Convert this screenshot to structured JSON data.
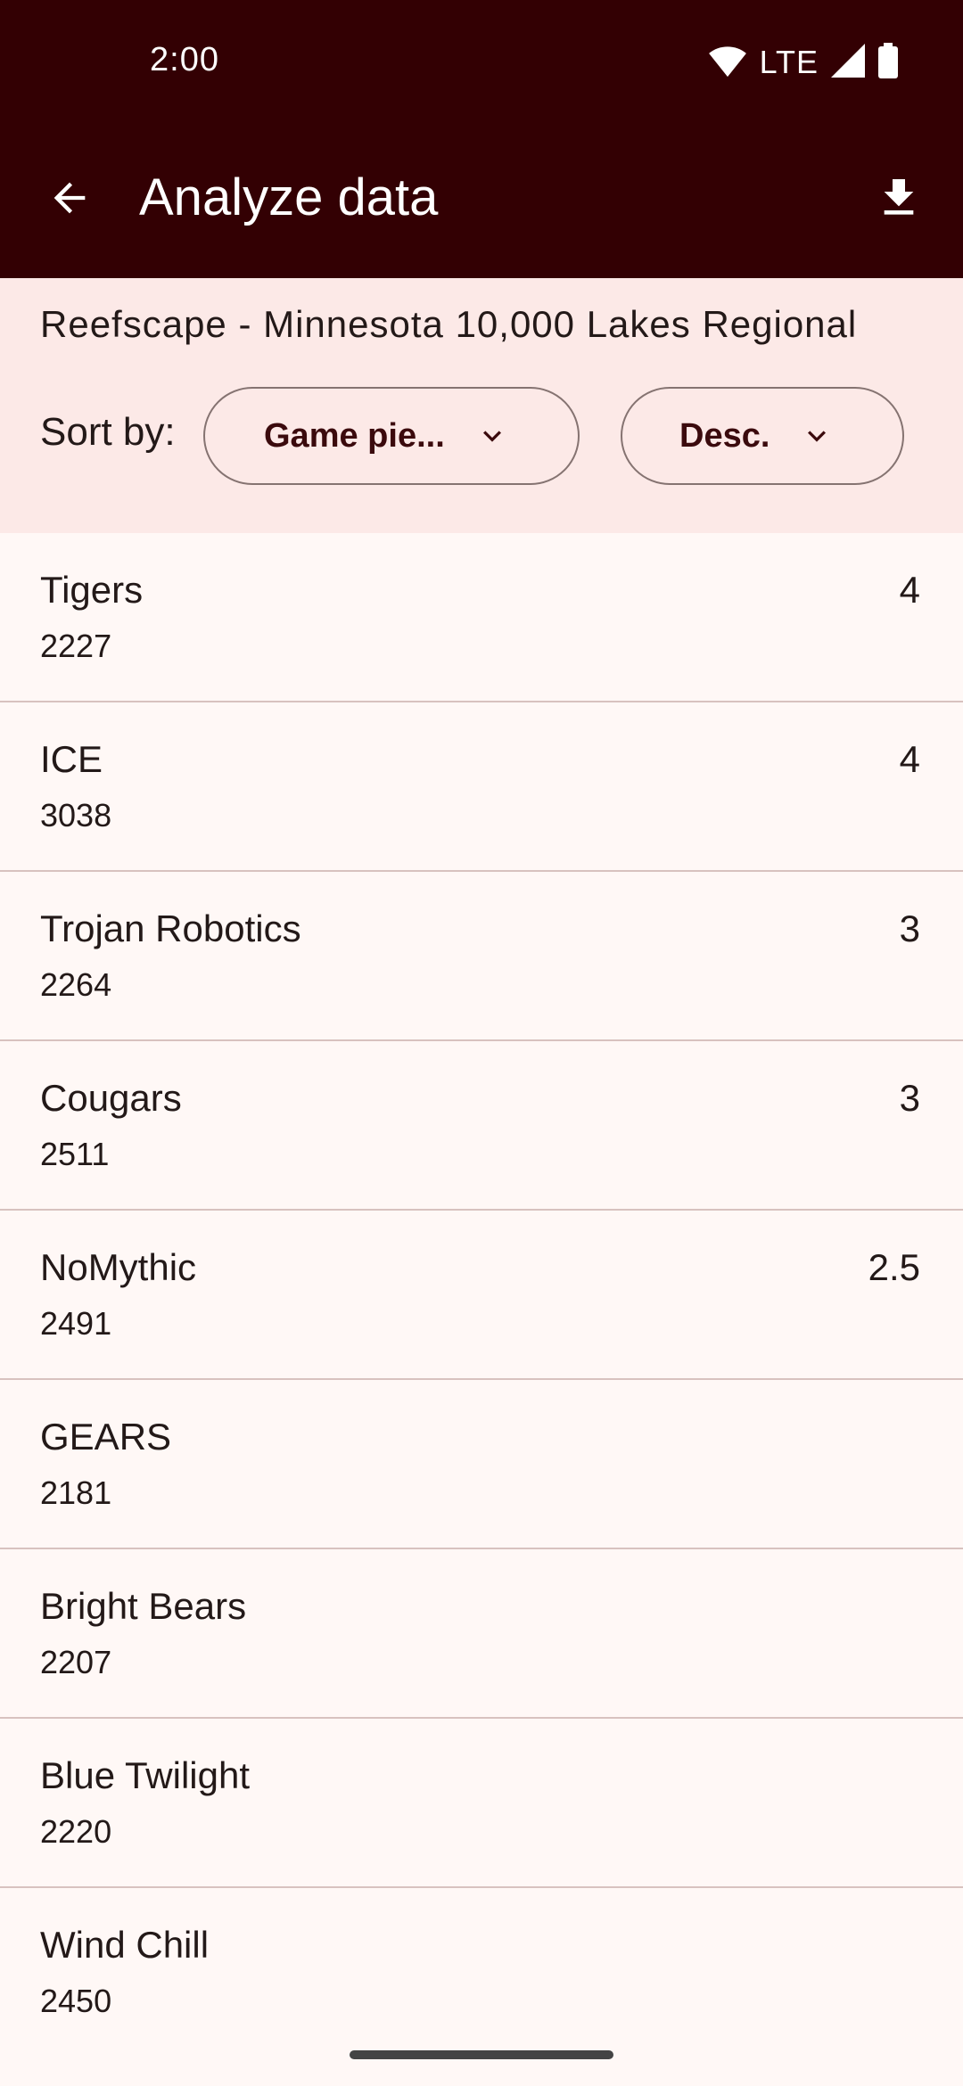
{
  "status_bar": {
    "time": "2:00",
    "network": "LTE",
    "icons": [
      "wifi-icon",
      "signal-icon",
      "battery-icon"
    ]
  },
  "app_bar": {
    "title": "Analyze data",
    "back_icon": "arrow-back-icon",
    "download_icon": "download-icon"
  },
  "header": {
    "event_name": "Reefscape - Minnesota 10,000 Lakes Regional",
    "sort_label": "Sort by:",
    "sort_field": "Game pie...",
    "sort_order": "Desc."
  },
  "teams": [
    {
      "name": "Tigers",
      "number": "2227",
      "value": "4"
    },
    {
      "name": "ICE",
      "number": "3038",
      "value": "4"
    },
    {
      "name": "Trojan Robotics",
      "number": "2264",
      "value": "3"
    },
    {
      "name": "Cougars",
      "number": "2511",
      "value": "3"
    },
    {
      "name": "NoMythic",
      "number": "2491",
      "value": "2.5"
    },
    {
      "name": "GEARS",
      "number": "2181",
      "value": ""
    },
    {
      "name": "Bright Bears",
      "number": "2207",
      "value": ""
    },
    {
      "name": "Blue Twilight",
      "number": "2220",
      "value": ""
    },
    {
      "name": "Wind Chill",
      "number": "2450",
      "value": ""
    }
  ],
  "colors": {
    "app_bar": "#330003",
    "header_panel": "#FCE9E7",
    "background": "#FFF8F6",
    "divider": "#D8C2BF",
    "text": "#231918"
  }
}
